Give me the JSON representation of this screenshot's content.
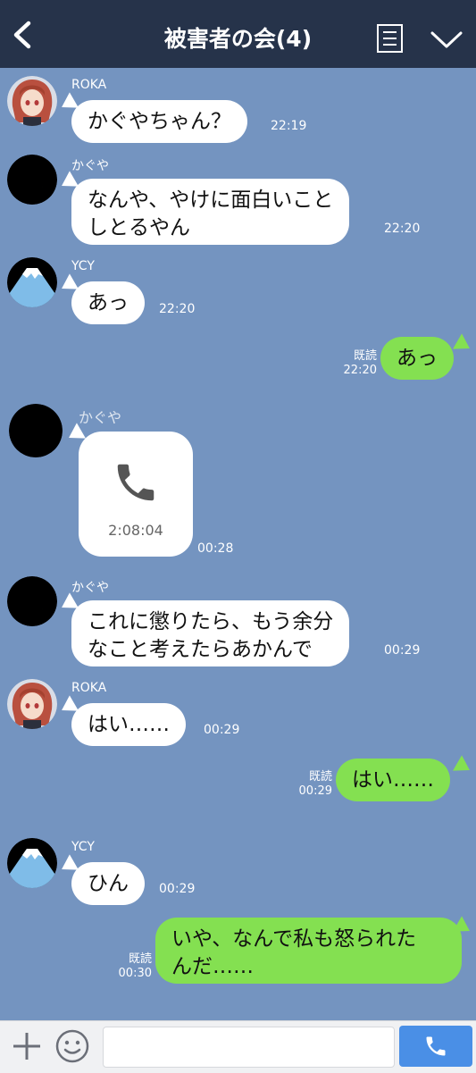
{
  "header": {
    "title": "被害者の会(4)",
    "back_icon": "chevron-left-icon",
    "menu_icon": "list-icon",
    "collapse_icon": "chevron-down-icon",
    "bg_color": "#26334a"
  },
  "chat": {
    "bg_color": "#7494c0",
    "messages": [
      {
        "sender": "ROKA",
        "text": "かぐやちゃん？",
        "time": "22:19"
      },
      {
        "sender": "かぐや",
        "text": "なんや、やけに面白いこと\nしとるやん",
        "time": "22:20"
      },
      {
        "sender": "YCY",
        "text": "あっ",
        "time": "22:20"
      },
      {
        "sender": "me",
        "text": "あっ",
        "read": "既読",
        "time": "22:20"
      },
      {
        "sender": "かぐや",
        "call_duration": "2:08:04",
        "time": "00:28"
      },
      {
        "sender": "かぐや",
        "text": "これに懲りたら、もう余分\nなこと考えたらあかんで",
        "time": "00:29"
      },
      {
        "sender": "ROKA",
        "text": "はい……",
        "time": "00:29"
      },
      {
        "sender": "me",
        "text": "はい……",
        "read": "既読",
        "time": "00:29"
      },
      {
        "sender": "YCY",
        "text": "ひん",
        "time": "00:29"
      },
      {
        "sender": "me",
        "text": "いや、なんで私も怒られた\nんだ……",
        "read": "既読",
        "time": "00:30"
      }
    ]
  },
  "bottom_bar": {
    "add_icon": "plus-icon",
    "emoji_icon": "smiley-icon",
    "input_value": "",
    "send_icon": "phone-icon",
    "accent": "#4a8fe6"
  },
  "colors": {
    "sent_bubble": "#84e051",
    "received_bubble": "#ffffff"
  }
}
